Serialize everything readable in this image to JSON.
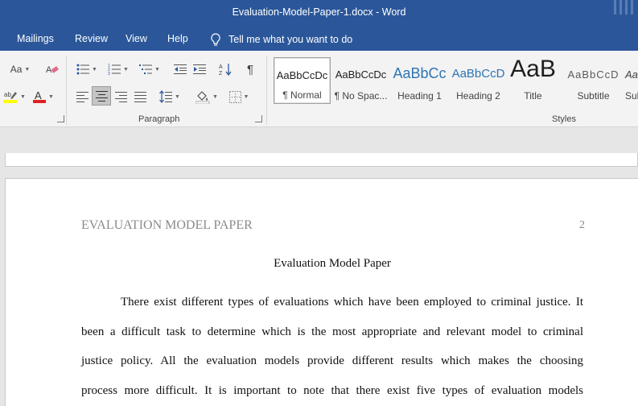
{
  "window": {
    "title": "Evaluation-Model-Paper-1.docx  -  Word"
  },
  "menu": {
    "items": [
      "Mailings",
      "Review",
      "View",
      "Help"
    ],
    "tell_me": "Tell me what you want to do"
  },
  "ribbon": {
    "font_size_button": "Aa",
    "paragraph_group_label": "Paragraph",
    "styles_group_label": "Styles",
    "styles": [
      {
        "sample": "AaBbCcDc",
        "name": "¶ Normal",
        "selected": true
      },
      {
        "sample": "AaBbCcDc",
        "name": "¶ No Spac..."
      },
      {
        "sample": "AaBbCc",
        "name": "Heading 1"
      },
      {
        "sample": "AaBbCcD",
        "name": "Heading 2"
      },
      {
        "sample": "AaB",
        "name": "Title"
      },
      {
        "sample": "AaBbCcD",
        "name": "Subtitle"
      },
      {
        "sample": "AaBbCcD",
        "name": "Subtle Em..."
      }
    ]
  },
  "document": {
    "running_head": "EVALUATION MODEL PAPER",
    "page_number": "2",
    "title": "Evaluation Model Paper",
    "body_lines": [
      "There exist different types of evaluations which have been employed to criminal justice. It",
      "been a difficult task to determine which is the most appropriate and relevant model to criminal",
      "justice policy. All the evaluation models provide different results which makes the choosing",
      "process more difficult. It is important to note that there exist five types of evaluation models"
    ]
  },
  "colors": {
    "brand": "#2b579a",
    "ribbon_bg": "#f3f3f3",
    "highlight": "#ffff00",
    "font_color": "#e02020"
  }
}
